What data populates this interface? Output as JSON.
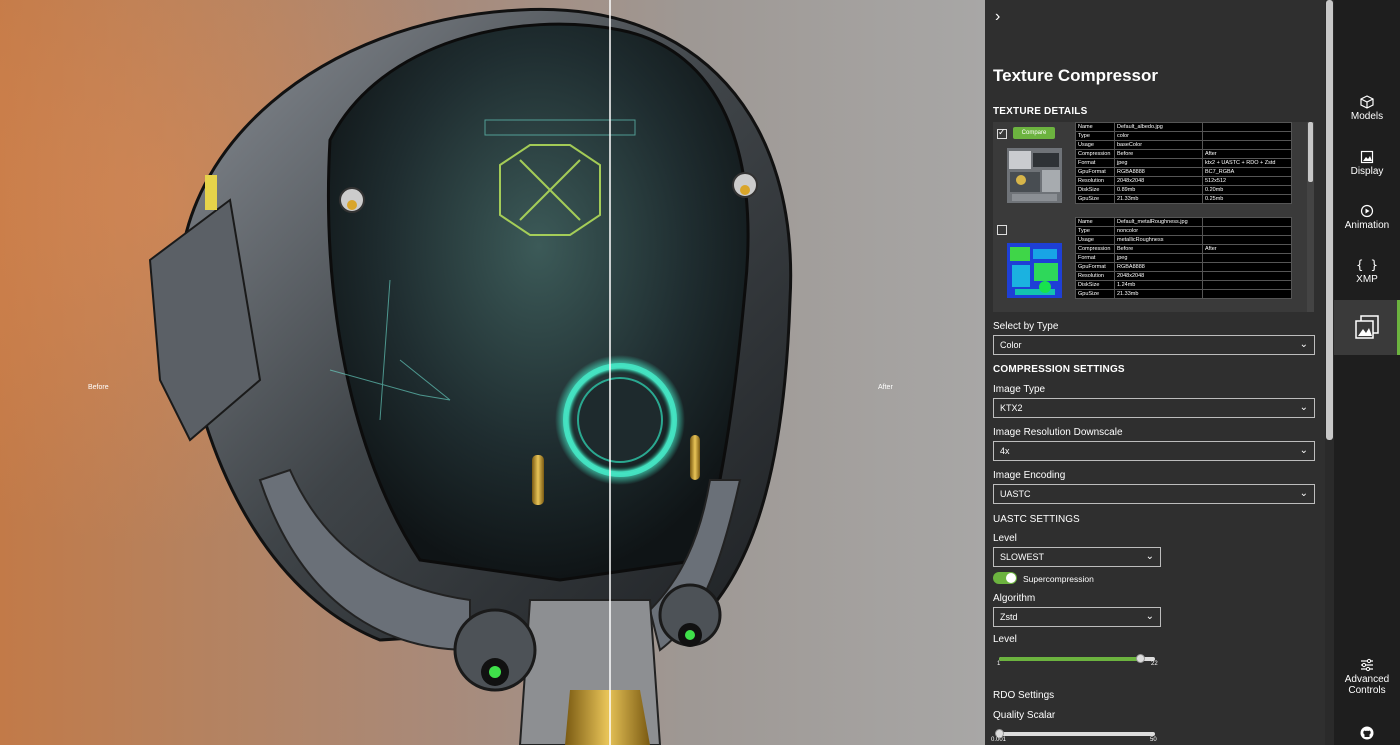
{
  "viewport": {
    "before_label": "Before",
    "after_label": "After"
  },
  "panel": {
    "toggle_icon": "chevron-right-icon",
    "title": "Texture Compressor",
    "texture_details_heading": "TEXTURE DETAILS",
    "compare_label": "Compare",
    "textures": [
      {
        "checked": true,
        "rows": [
          [
            "Name",
            "Default_albedo.jpg",
            ""
          ],
          [
            "Type",
            "color",
            ""
          ],
          [
            "Usage",
            "baseColor",
            ""
          ],
          [
            "Compression",
            "Before",
            "After"
          ],
          [
            "Format",
            "jpeg",
            "ktx2 + UASTC + RDO + Zstd"
          ],
          [
            "GpuFormat",
            "RGBA8888",
            "BC7_RGBA"
          ],
          [
            "Resolution",
            "2048x2048",
            "512x512"
          ],
          [
            "DiskSize",
            "0.89mb",
            "0.20mb"
          ],
          [
            "GpuSize",
            "21.33mb",
            "0.25mb"
          ]
        ]
      },
      {
        "checked": false,
        "rows": [
          [
            "Name",
            "Default_metalRoughness.jpg",
            ""
          ],
          [
            "Type",
            "noncolor",
            ""
          ],
          [
            "Usage",
            "metallicRoughness",
            ""
          ],
          [
            "Compression",
            "Before",
            "After"
          ],
          [
            "Format",
            "jpeg",
            ""
          ],
          [
            "GpuFormat",
            "RGBA8888",
            ""
          ],
          [
            "Resolution",
            "2048x2048",
            ""
          ],
          [
            "DiskSize",
            "1.24mb",
            ""
          ],
          [
            "GpuSize",
            "21.33mb",
            ""
          ]
        ]
      }
    ],
    "select_by_type_label": "Select by Type",
    "select_by_type_value": "Color",
    "compression_heading": "COMPRESSION SETTINGS",
    "image_type_label": "Image Type",
    "image_type_value": "KTX2",
    "downscale_label": "Image Resolution Downscale",
    "downscale_value": "4x",
    "encoding_label": "Image Encoding",
    "encoding_value": "UASTC",
    "uastc_heading": "UASTC SETTINGS",
    "level_label": "Level",
    "level_value": "SLOWEST",
    "supercompression_label": "Supercompression",
    "supercompression_on": true,
    "algorithm_label": "Algorithm",
    "algorithm_value": "Zstd",
    "zstd_level_label": "Level",
    "zstd_level": {
      "min": "1",
      "max": "22",
      "value": 20
    },
    "rdo_heading": "RDO Settings",
    "quality_scalar_label": "Quality Scalar",
    "quality_scalar": {
      "min": "0.001",
      "max": "50",
      "value": 0.001
    }
  },
  "rail": {
    "items": [
      {
        "label": "Models",
        "icon": "cube-icon"
      },
      {
        "label": "Display",
        "icon": "image-icon"
      },
      {
        "label": "Animation",
        "icon": "animation-icon"
      },
      {
        "label": "XMP",
        "icon": "braces-icon"
      },
      {
        "label": "",
        "icon": "texture-compressor-icon"
      },
      {
        "label": "Advanced Controls",
        "icon": "sliders-icon"
      }
    ],
    "github_icon": "github-icon"
  },
  "colors": {
    "accent": "#6cb33f",
    "panel_bg": "#2f2f2f",
    "rail_bg": "#1e1e1e"
  }
}
